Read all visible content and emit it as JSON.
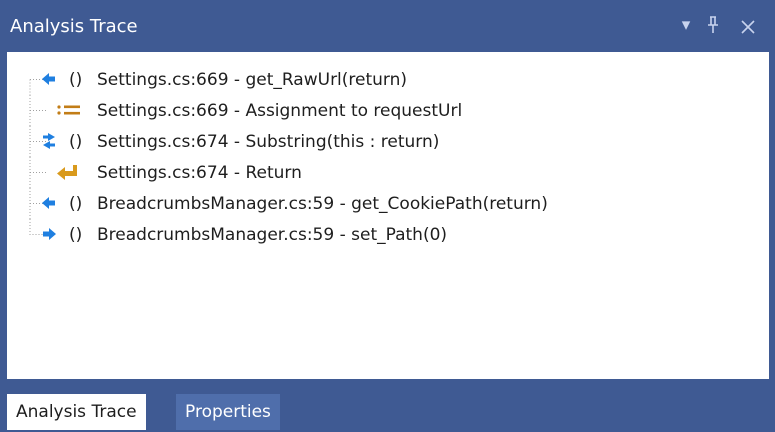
{
  "panel": {
    "title": "Analysis Trace",
    "controls": {
      "dropdown": "▾",
      "pin": "ꟼ",
      "close": "✕"
    }
  },
  "trace_items": [
    {
      "icon": "method-return-icon",
      "label": "Settings.cs:669 - get_RawUrl(return)"
    },
    {
      "icon": "assignment-icon",
      "label": "Settings.cs:669 - Assignment to requestUrl"
    },
    {
      "icon": "method-this-return-icon",
      "label": "Settings.cs:674 - Substring(this : return)"
    },
    {
      "icon": "return-statement-icon",
      "label": "Settings.cs:674 - Return"
    },
    {
      "icon": "method-return-icon",
      "label": "BreadcrumbsManager.cs:59 - get_CookiePath(return)"
    },
    {
      "icon": "method-argument-icon",
      "label": "BreadcrumbsManager.cs:59 - set_Path(0)"
    }
  ],
  "tabs": [
    {
      "label": "Analysis Trace",
      "active": true
    },
    {
      "label": "Properties",
      "active": false
    }
  ],
  "colors": {
    "chrome": "#3f5a93",
    "method_blue": "#1f7fe0",
    "assignment_orange": "#c27d17",
    "return_gold": "#d99a1c"
  }
}
